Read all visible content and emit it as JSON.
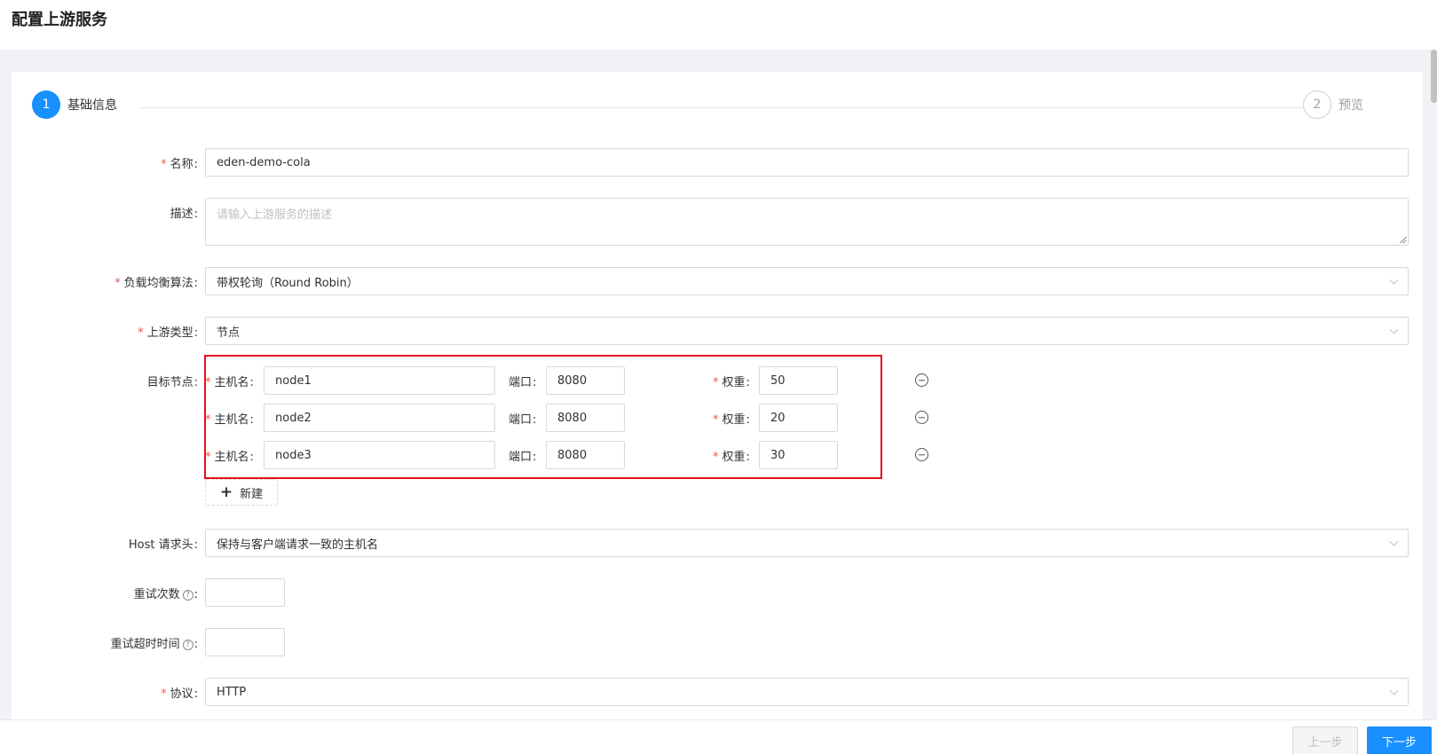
{
  "page": {
    "title": "配置上游服务"
  },
  "steps": [
    {
      "number": "1",
      "label": "基础信息"
    },
    {
      "number": "2",
      "label": "预览"
    }
  ],
  "form": {
    "name": {
      "label": "名称",
      "value": "eden-demo-cola"
    },
    "description": {
      "label": "描述",
      "placeholder": "请输入上游服务的描述",
      "value": ""
    },
    "lb_algorithm": {
      "label": "负载均衡算法",
      "value": "带权轮询（Round Robin）"
    },
    "upstream_type": {
      "label": "上游类型",
      "value": "节点"
    },
    "target_nodes": {
      "label": "目标节点",
      "host_label": "主机名",
      "port_label": "端口",
      "weight_label": "权重",
      "nodes": [
        {
          "host": "node1",
          "port": "8080",
          "weight": "50"
        },
        {
          "host": "node2",
          "port": "8080",
          "weight": "20"
        },
        {
          "host": "node3",
          "port": "8080",
          "weight": "30"
        }
      ],
      "add_label": "新建"
    },
    "host_header": {
      "label": "Host 请求头",
      "value": "保持与客户端请求一致的主机名"
    },
    "retries": {
      "label": "重试次数",
      "value": ""
    },
    "retry_timeout": {
      "label": "重试超时时间",
      "value": ""
    },
    "protocol": {
      "label": "协议",
      "value": "HTTP"
    }
  },
  "footer": {
    "prev_label": "上一步",
    "next_label": "下一步"
  },
  "colors": {
    "primary": "#1890ff",
    "required": "#ff4d4f",
    "highlight": "#e3101b"
  }
}
